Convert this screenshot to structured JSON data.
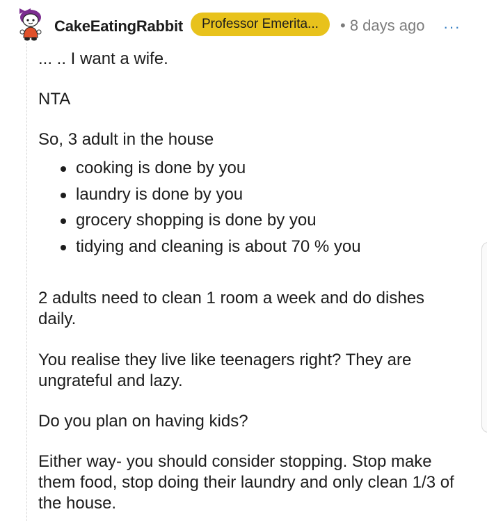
{
  "comment": {
    "username": "CakeEatingRabbit",
    "flair": "Professor Emerita...",
    "separator": "•",
    "timestamp": "8 days ago",
    "more_label": "···",
    "avatar_icon": "snoo-avatar-icon",
    "body": {
      "p1": "... .. I want a wife.",
      "p2": "NTA",
      "p3": "So, 3 adult in the house",
      "bullets": [
        "cooking is done by you",
        "laundry is done by you",
        "grocery shopping is done by you",
        "tidying and cleaning is about 70 % you"
      ],
      "p4": "2 adults need to clean 1 room a week and do dishes daily.",
      "p5": "You realise they live like teenagers right? They are ungrateful and lazy.",
      "p6": "Do you plan on having kids?",
      "p7": "Either way- you should consider stopping. Stop make them food, stop doing their laundry and only clean 1/3 of the house."
    }
  },
  "colors": {
    "flair_bg": "#e8c21c",
    "meta_text": "#7c7c7c",
    "more_icon": "#3b82c4",
    "avatar_hair": "#7b2c8f",
    "avatar_shirt": "#e0502a"
  }
}
